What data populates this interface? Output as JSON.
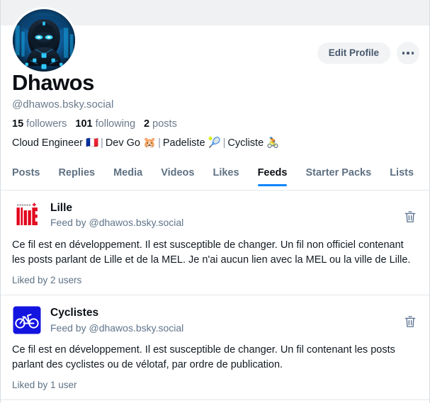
{
  "colors": {
    "accent": "#1185fe",
    "banner": "#f0f1f3",
    "muted_text": "#6b7a8c",
    "pill_bg": "#f1f3f5",
    "border": "#e3e8ed"
  },
  "profile": {
    "display_name": "Dhawos",
    "handle": "@dhawos.bsky.social",
    "avatar_alt": "cyberpunk-avatar",
    "stats": [
      {
        "count": "15",
        "label": "followers"
      },
      {
        "count": "101",
        "label": "following"
      },
      {
        "count": "2",
        "label": "posts"
      }
    ],
    "bio_segments": [
      "Cloud Engineer 🇫🇷",
      "Dev Go 🐹",
      "Padeliste 🎾",
      "Cycliste 🚴"
    ],
    "bio_separator": "|"
  },
  "actions": {
    "edit_profile_label": "Edit Profile",
    "more_label": "more-options"
  },
  "tabs": [
    {
      "label": "Posts",
      "active": false
    },
    {
      "label": "Replies",
      "active": false
    },
    {
      "label": "Media",
      "active": false
    },
    {
      "label": "Videos",
      "active": false
    },
    {
      "label": "Likes",
      "active": false
    },
    {
      "label": "Feeds",
      "active": true
    },
    {
      "label": "Starter Packs",
      "active": false
    },
    {
      "label": "Lists",
      "active": false
    }
  ],
  "feeds": [
    {
      "title": "Lille",
      "byline": "Feed by @dhawos.bsky.social",
      "description": "Ce fil est en développement. Il est susceptible de changer. Un fil non officiel contenant les posts parlant de Lille et de la MEL.\n Je n'ai aucun lien avec la MEL ou la ville de Lille.",
      "liked_by": "Liked by 2 users",
      "thumb": "lille-logo",
      "delete_label": "delete-feed"
    },
    {
      "title": "Cyclistes",
      "byline": "Feed by @dhawos.bsky.social",
      "description": "Ce fil est en développement. Il est susceptible de changer. Un fil contenant les posts parlant des cyclistes ou de vélotaf, par ordre de publication.",
      "liked_by": "Liked by 1 user",
      "thumb": "bicycle-sign",
      "delete_label": "delete-feed"
    }
  ]
}
